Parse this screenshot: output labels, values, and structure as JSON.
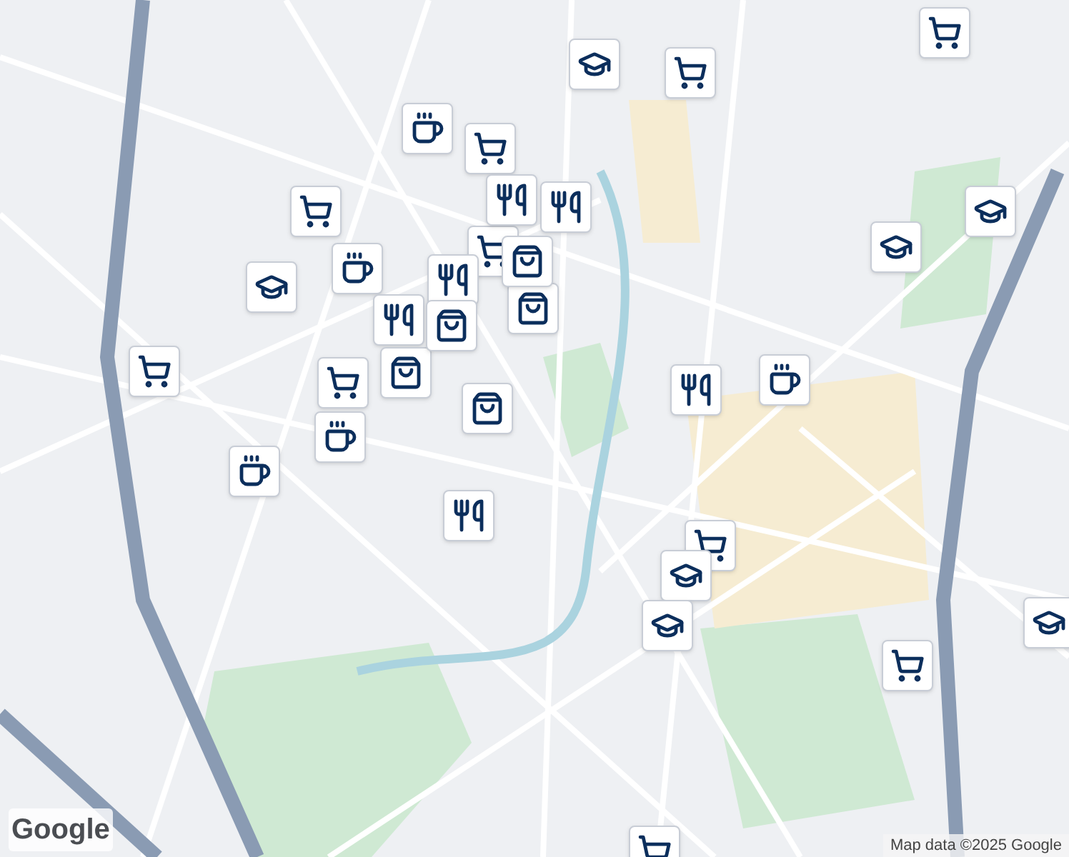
{
  "map": {
    "markers": [
      {
        "kind": "cart"
      },
      {
        "kind": "cart"
      },
      {
        "kind": "cart"
      },
      {
        "kind": "cart"
      },
      {
        "kind": "cart"
      },
      {
        "kind": "cart"
      },
      {
        "kind": "cart"
      },
      {
        "kind": "cart"
      },
      {
        "kind": "cart"
      },
      {
        "kind": "cart"
      },
      {
        "kind": "school"
      },
      {
        "kind": "school"
      },
      {
        "kind": "school"
      },
      {
        "kind": "school"
      },
      {
        "kind": "school"
      },
      {
        "kind": "school"
      },
      {
        "kind": "school"
      },
      {
        "kind": "cafe"
      },
      {
        "kind": "cafe"
      },
      {
        "kind": "cafe"
      },
      {
        "kind": "cafe"
      },
      {
        "kind": "cafe"
      },
      {
        "kind": "restaurant"
      },
      {
        "kind": "restaurant"
      },
      {
        "kind": "restaurant"
      },
      {
        "kind": "restaurant"
      },
      {
        "kind": "restaurant"
      },
      {
        "kind": "restaurant"
      },
      {
        "kind": "bag"
      },
      {
        "kind": "bag"
      },
      {
        "kind": "bag"
      },
      {
        "kind": "bag"
      },
      {
        "kind": "bag"
      }
    ]
  },
  "logo": "Google",
  "attribution": "Map data ©2025 Google"
}
